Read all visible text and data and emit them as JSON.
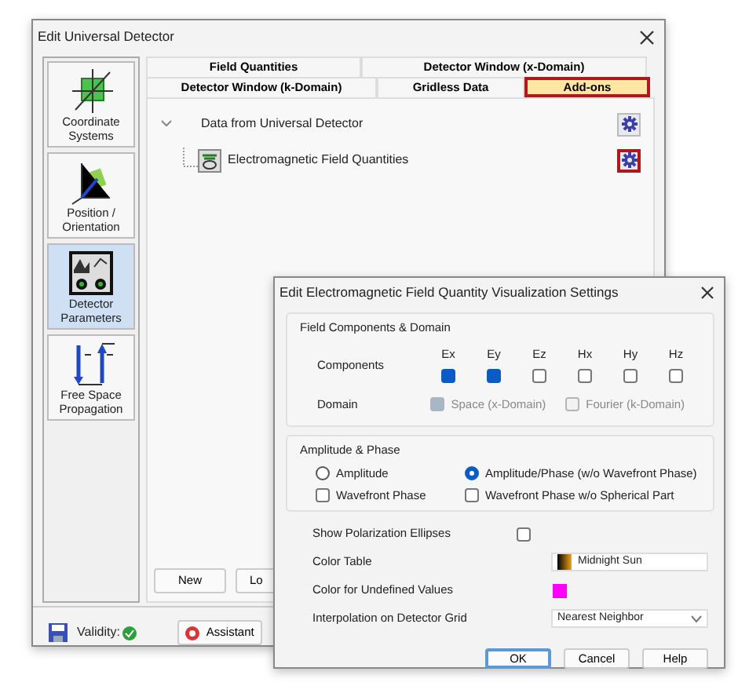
{
  "main_window": {
    "title": "Edit Universal Detector",
    "sidebar": [
      {
        "kind": "coordinates",
        "label": "Coordinate Systems",
        "selected": false
      },
      {
        "kind": "position",
        "label": "Position / Orientation",
        "selected": false
      },
      {
        "kind": "detector",
        "label": "Detector Parameters",
        "selected": true
      },
      {
        "kind": "propagation",
        "label": "Free Space Propagation",
        "selected": false
      }
    ],
    "tab_rows": [
      {
        "tabs": [
          {
            "label": "Field Quantities",
            "selected": false
          },
          {
            "label": "Detector Window (x-Domain)",
            "selected": false
          }
        ]
      },
      {
        "tabs": [
          {
            "label": "Detector Window (k-Domain)",
            "selected": false
          },
          {
            "label": "Gridless Data",
            "selected": false
          },
          {
            "label": "Add-ons",
            "selected": true
          }
        ]
      }
    ],
    "tree": [
      {
        "label": "Data from Universal Detector",
        "expanded": true,
        "highlighted": false,
        "children": [
          {
            "label": "Electromagnetic Field Quantities",
            "highlighted": true
          }
        ]
      }
    ],
    "buttons": [
      "New",
      "Lo"
    ],
    "validity": {
      "label": "Validity:",
      "valid": true
    },
    "assistant": "Assistant"
  },
  "settings_dialog": {
    "title": "Edit Electromagnetic Field Quantity Visualization Settings",
    "components_group": {
      "title": "Field Components & Domain",
      "components_label": "Components",
      "components": [
        {
          "label": "Ex",
          "checked": true
        },
        {
          "label": "Ey",
          "checked": true
        },
        {
          "label": "Ez",
          "checked": false
        },
        {
          "label": "Hx",
          "checked": false
        },
        {
          "label": "Hy",
          "checked": false
        },
        {
          "label": "Hz",
          "checked": false
        }
      ],
      "domain_label": "Domain",
      "domains": [
        {
          "label": "Space (x-Domain)",
          "checked": true,
          "disabled": true
        },
        {
          "label": "Fourier (k-Domain)",
          "checked": false,
          "disabled": true
        }
      ]
    },
    "phase_group": {
      "title": "Amplitude & Phase",
      "options": [
        {
          "kind": "radio",
          "label": "Amplitude",
          "checked": false
        },
        {
          "kind": "radio",
          "label": "Amplitude/Phase (w/o Wavefront Phase)",
          "checked": true
        },
        {
          "kind": "checkbox",
          "label": "Wavefront Phase",
          "checked": false
        },
        {
          "kind": "checkbox",
          "label": "Wavefront Phase w/o Spherical Part",
          "checked": false
        }
      ]
    },
    "polarization": {
      "label": "Show Polarization Ellipses",
      "checked": false
    },
    "color_table": {
      "label": "Color Table",
      "value": "Midnight Sun"
    },
    "undefined_color": {
      "label": "Color for Undefined Values",
      "color": "#ff00ff"
    },
    "interpolation": {
      "label": "Interpolation on Detector Grid",
      "value": "Nearest Neighbor"
    },
    "buttons": [
      {
        "label": "OK",
        "default": true
      },
      {
        "label": "Cancel",
        "default": false
      },
      {
        "label": "Help",
        "default": false
      }
    ]
  }
}
